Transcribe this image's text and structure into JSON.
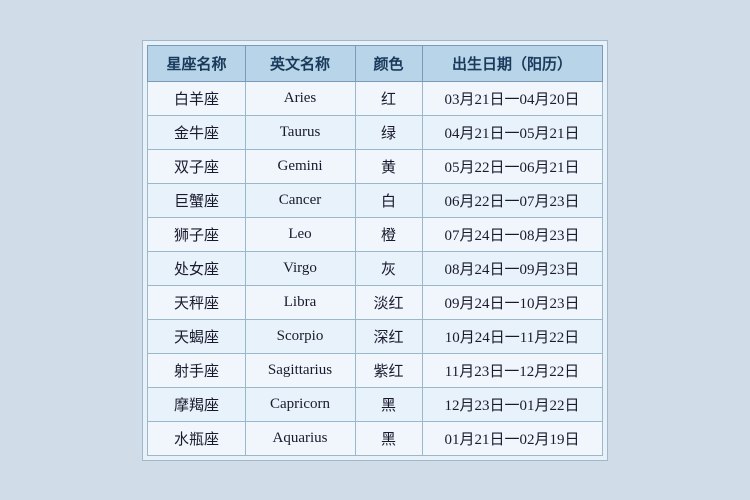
{
  "table": {
    "headers": [
      "星座名称",
      "英文名称",
      "颜色",
      "出生日期（阳历）"
    ],
    "rows": [
      {
        "chinese": "白羊座",
        "english": "Aries",
        "color": "红",
        "date": "03月21日一04月20日"
      },
      {
        "chinese": "金牛座",
        "english": "Taurus",
        "color": "绿",
        "date": "04月21日一05月21日"
      },
      {
        "chinese": "双子座",
        "english": "Gemini",
        "color": "黄",
        "date": "05月22日一06月21日"
      },
      {
        "chinese": "巨蟹座",
        "english": "Cancer",
        "color": "白",
        "date": "06月22日一07月23日"
      },
      {
        "chinese": "狮子座",
        "english": "Leo",
        "color": "橙",
        "date": "07月24日一08月23日"
      },
      {
        "chinese": "处女座",
        "english": "Virgo",
        "color": "灰",
        "date": "08月24日一09月23日"
      },
      {
        "chinese": "天秤座",
        "english": "Libra",
        "color": "淡红",
        "date": "09月24日一10月23日"
      },
      {
        "chinese": "天蝎座",
        "english": "Scorpio",
        "color": "深红",
        "date": "10月24日一11月22日"
      },
      {
        "chinese": "射手座",
        "english": "Sagittarius",
        "color": "紫红",
        "date": "11月23日一12月22日"
      },
      {
        "chinese": "摩羯座",
        "english": "Capricorn",
        "color": "黑",
        "date": "12月23日一01月22日"
      },
      {
        "chinese": "水瓶座",
        "english": "Aquarius",
        "color": "黑",
        "date": "01月21日一02月19日"
      }
    ]
  }
}
